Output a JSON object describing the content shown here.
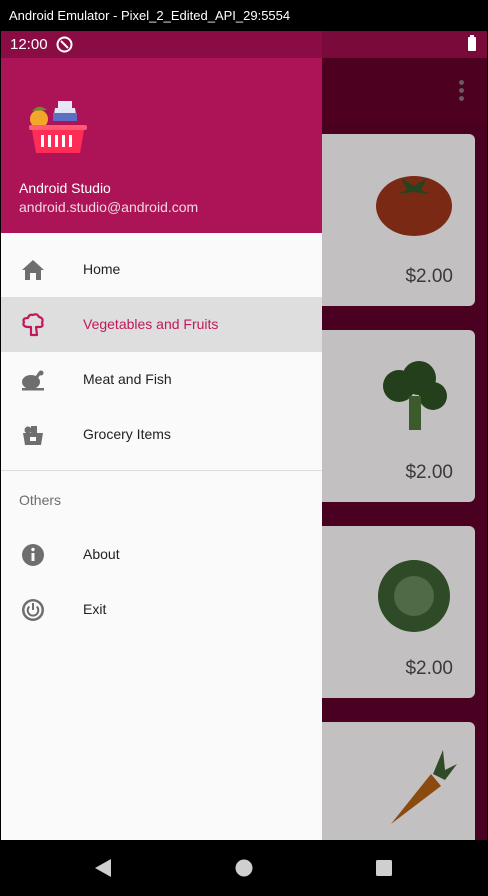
{
  "window": {
    "title": "Android Emulator - Pixel_2_Edited_API_29:5554"
  },
  "status_bar": {
    "time": "12:00"
  },
  "drawer": {
    "header": {
      "name": "Android Studio",
      "email": "android.studio@android.com"
    },
    "items": [
      {
        "label": "Home",
        "icon": "home-icon",
        "selected": false
      },
      {
        "label": "Vegetables and Fruits",
        "icon": "broccoli-icon",
        "selected": true
      },
      {
        "label": "Meat and Fish",
        "icon": "chicken-leg-icon",
        "selected": false
      },
      {
        "label": "Grocery Items",
        "icon": "basket-icon",
        "selected": false
      }
    ],
    "section_title": "Others",
    "other_items": [
      {
        "label": "About",
        "icon": "info-icon"
      },
      {
        "label": "Exit",
        "icon": "power-icon"
      }
    ]
  },
  "products": [
    {
      "price": "$2.00",
      "image": "tomato"
    },
    {
      "price": "$2.00",
      "image": "broccoli"
    },
    {
      "price": "$2.00",
      "image": "cabbage"
    },
    {
      "price": "",
      "image": "carrot"
    }
  ],
  "colors": {
    "primary": "#ad1457",
    "accent": "#c2185b",
    "scrim": "#4a0020"
  }
}
